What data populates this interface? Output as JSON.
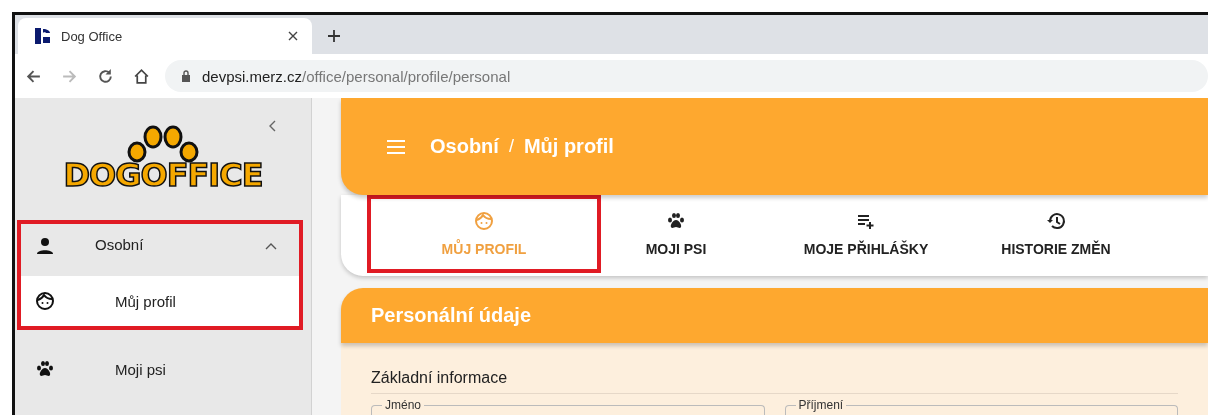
{
  "browser": {
    "tab_title": "Dog Office",
    "url_host": "devpsi.merz.cz",
    "url_path": "/office/personal/profile/personal"
  },
  "sidebar": {
    "logo_text": "DOGOFFICE",
    "items": [
      {
        "label": "Osobní",
        "kind": "person",
        "expanded": true,
        "selected": false,
        "highlighted": true,
        "children": [
          {
            "label": "Můj profil",
            "kind": "face",
            "selected": true
          }
        ]
      },
      {
        "label": "Moji psi",
        "kind": "paw",
        "selected": false,
        "highlighted": false
      }
    ]
  },
  "header": {
    "breadcrumb": [
      "Osobní",
      "Můj profil"
    ],
    "separator": "/"
  },
  "tabs": [
    {
      "label": "MŮJ PROFIL",
      "kind": "face",
      "selected": true,
      "highlighted": true
    },
    {
      "label": "MOJI PSI",
      "kind": "paw",
      "selected": false,
      "highlighted": false
    },
    {
      "label": "MOJE PŘIHLÁŠKY",
      "kind": "playlist-add",
      "selected": false,
      "highlighted": false
    },
    {
      "label": "HISTORIE ZMĚN",
      "kind": "history",
      "selected": false,
      "highlighted": false
    }
  ],
  "section": {
    "title": "Personální údaje",
    "subtitle": "Základní informace",
    "fields": [
      {
        "label": "Jméno"
      },
      {
        "label": "Příjmení"
      }
    ]
  }
}
